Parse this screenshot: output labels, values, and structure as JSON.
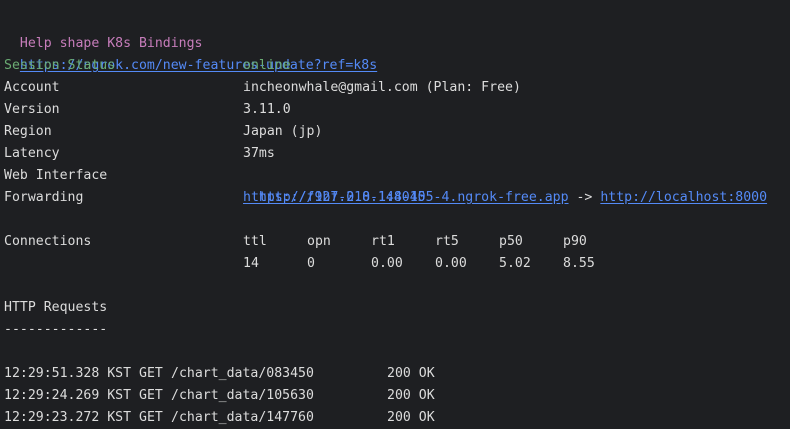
{
  "banner": {
    "text": "Help shape K8s Bindings",
    "link": "https://ngrok.com/new-features-update?ref=k8s"
  },
  "session": {
    "status_label": "Session Status",
    "status_value": "online",
    "account_label": "Account",
    "account_value": "incheonwhale@gmail.com (Plan: Free)",
    "version_label": "Version",
    "version_value": "3.11.0",
    "region_label": "Region",
    "region_value": "Japan (jp)",
    "latency_label": "Latency",
    "latency_value": "37ms",
    "web_interface_label": "Web Interface",
    "web_interface_value": "http://127.0.0.1:4040",
    "forwarding_label": "Forwarding",
    "forwarding_public": "https://f9bf-218-148-155-4.ngrok-free.app",
    "forwarding_arrow": "->",
    "forwarding_local": "http://localhost:8000"
  },
  "connections": {
    "label": "Connections",
    "headers": [
      "ttl",
      "opn",
      "rt1",
      "rt5",
      "p50",
      "p90"
    ],
    "values": [
      "14",
      "0",
      "0.00",
      "0.00",
      "5.02",
      "8.55"
    ]
  },
  "http_requests": {
    "title": "HTTP Requests",
    "divider": "-------------",
    "rows": [
      {
        "time": "12:29:51.328 KST",
        "method": "GET",
        "path": "/chart_data/083450",
        "status": "200 OK"
      },
      {
        "time": "12:29:24.269 KST",
        "method": "GET",
        "path": "/chart_data/105630",
        "status": "200 OK"
      },
      {
        "time": "12:29:23.272 KST",
        "method": "GET",
        "path": "/chart_data/147760",
        "status": "200 OK"
      }
    ]
  }
}
